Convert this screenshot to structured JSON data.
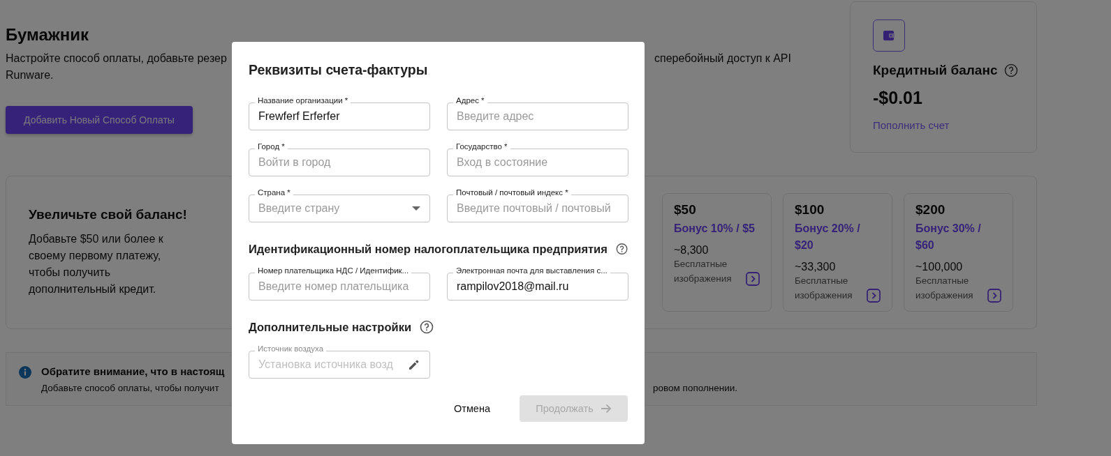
{
  "page": {
    "title": "Бумажник",
    "description_left": "Настройте способ оплаты, добавьте резер",
    "description_right": "сперебойный доступ к API",
    "description_line2": "Runware.",
    "add_button": "Добавить Новый Способ Оплаты"
  },
  "balance_card": {
    "title": "Кредитный баланс",
    "amount": "-$0.01",
    "topup_link": "Пополнить счет"
  },
  "promo": {
    "title": "Увеличьте свой баланс!",
    "text": "Добавьте $50 или более к своему первому платежу, чтобы получить дополнительный кредит.",
    "tiers": [
      {
        "amount": "$50",
        "bonus": "Бонус 10% / $5",
        "images": "~8,300",
        "images_label": "Бесплатные изображения"
      },
      {
        "amount": "$100",
        "bonus": "Бонус 20% / $20",
        "images": "~33,300",
        "images_label": "Бесплатные изображения"
      },
      {
        "amount": "$200",
        "bonus": "Бонус 30% / $60",
        "images": "~100,000",
        "images_label": "Бесплатные изображения"
      }
    ]
  },
  "notice": {
    "title": "Обратите внимание, что в настоящ",
    "text_left": "Добавьте способ оплаты, чтобы получит",
    "text_right": "ровом пополнении."
  },
  "dialog": {
    "title": "Реквизиты счета-фактуры",
    "fields": [
      {
        "kind": "text",
        "label": "Название организации *",
        "value": "Frewferf Erferfer",
        "disabled": false
      },
      {
        "kind": "text",
        "label": "Адрес *",
        "placeholder": "Введите адрес",
        "disabled": false
      },
      {
        "kind": "text",
        "label": "Город *",
        "placeholder": "Войти в город",
        "disabled": false
      },
      {
        "kind": "text",
        "label": "Государство *",
        "placeholder": "Вход в состояние",
        "disabled": false
      },
      {
        "kind": "select",
        "label": "Страна *",
        "placeholder": "Введите страну",
        "disabled": false
      },
      {
        "kind": "text",
        "label": "Почтовый / почтовый индекс *",
        "placeholder": "Введите почтовый / почтовый",
        "disabled": false
      }
    ],
    "sections": [
      {
        "heading": "Идентификационный номер налогоплательщика предприятия",
        "fields": [
          {
            "kind": "text",
            "label": "Номер плательщика НДС / Идентифик...",
            "placeholder": "Введите номер плательщика",
            "disabled": false
          },
          {
            "kind": "text",
            "label": "Электронная почта для выставления с...",
            "value": "rampilov2018@mail.ru",
            "disabled": false
          }
        ]
      },
      {
        "heading": "Дополнительные настройки",
        "fields": [
          {
            "kind": "edit",
            "label": "Источник воздуха",
            "placeholder": "Установка источника возд",
            "disabled": true
          }
        ]
      }
    ],
    "cancel_button": "Отмена",
    "continue_button": {
      "label": "Продолжать",
      "disabled": true
    }
  }
}
